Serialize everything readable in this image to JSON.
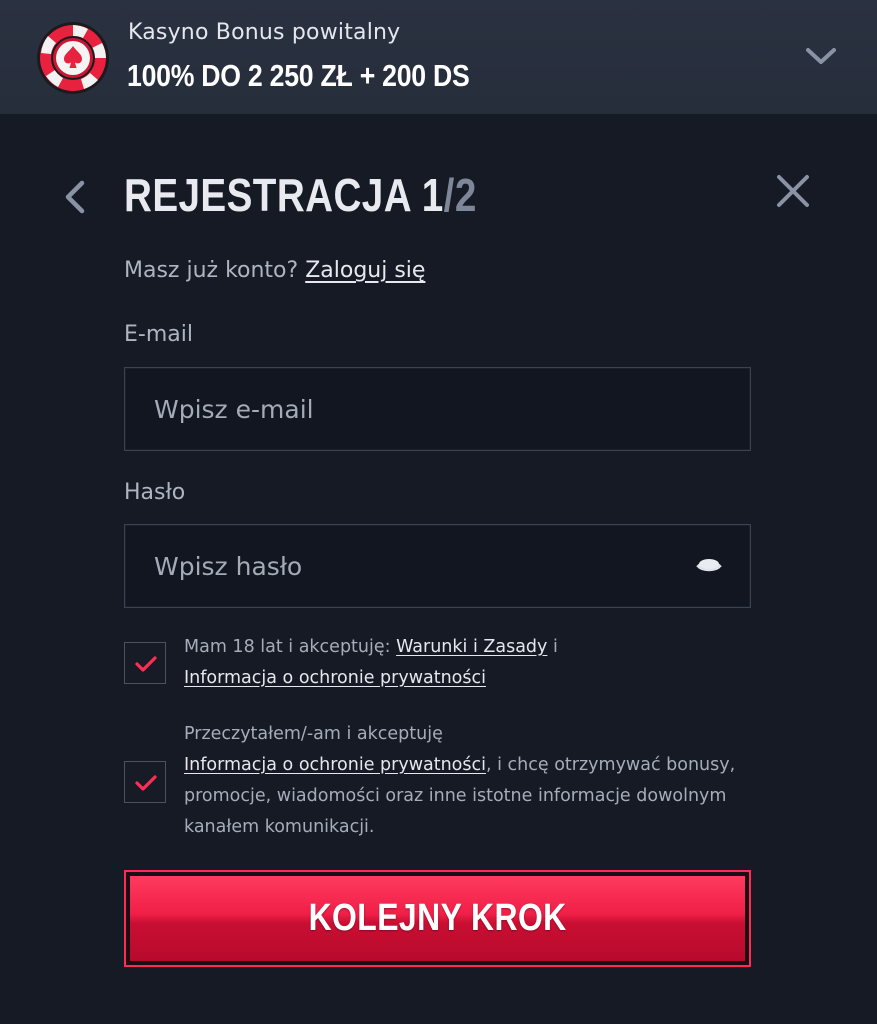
{
  "banner": {
    "subtitle": "Kasyno Bonus powitalny",
    "title": "100% DO 2 250 ZŁ + 200 DS",
    "chip_icon": "poker-chip-icon",
    "toggle_icon": "chevron-down-icon"
  },
  "header": {
    "title_main": "REJESTRACJA 1",
    "title_sep": "/",
    "title_total": "2",
    "back_icon": "chevron-left-icon",
    "close_icon": "close-icon"
  },
  "login": {
    "prompt": "Masz już konto?",
    "link": "Zaloguj się"
  },
  "form": {
    "email": {
      "label": "E-mail",
      "placeholder": "Wpisz e-mail",
      "value": ""
    },
    "password": {
      "label": "Hasło",
      "placeholder": "Wpisz hasło",
      "value": "",
      "toggle_icon": "eye-icon"
    }
  },
  "consents": [
    {
      "checked": true,
      "text_before": "Mam 18 lat i akceptuję: ",
      "link1": "Warunki i Zasady",
      "text_middle": " i",
      "link2": "Informacja o ochronie prywatności"
    },
    {
      "checked": true,
      "text_before": "Przeczytałem/-am i akceptuję",
      "link": "Informacja o ochronie prywatności",
      "text_after": ", i chcę otrzymywać bonusy, promocje, wiadomości oraz inne istotne informacje dowolnym kanałem komunikacji."
    }
  ],
  "submit": {
    "label": "KOLEJNY KROK"
  },
  "colors": {
    "background": "#151a24",
    "banner": "#2a3140",
    "accent": "#f01f47",
    "check": "#ff2d55",
    "muted_text": "#7e8699"
  }
}
